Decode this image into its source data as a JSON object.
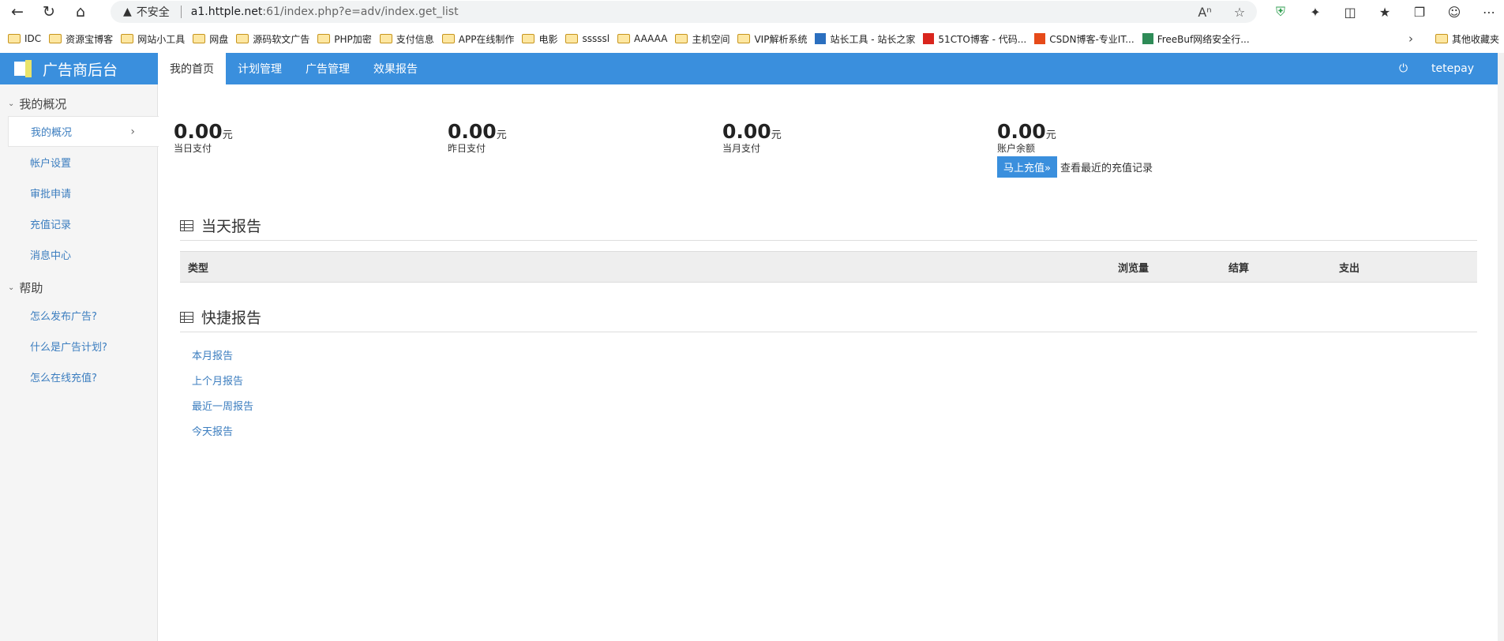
{
  "browser": {
    "security_label": "不安全",
    "url_host": "a1.httple.net",
    "url_rest": ":61/index.php?e=adv/index.get_list"
  },
  "bookmarks": [
    {
      "label": "IDC",
      "icon": "folder"
    },
    {
      "label": "资源宝博客",
      "icon": "folder"
    },
    {
      "label": "网站小工具",
      "icon": "folder"
    },
    {
      "label": "网盘",
      "icon": "folder"
    },
    {
      "label": "源码软文广告",
      "icon": "folder"
    },
    {
      "label": "PHP加密",
      "icon": "folder"
    },
    {
      "label": "支付信息",
      "icon": "folder"
    },
    {
      "label": "APP在线制作",
      "icon": "folder"
    },
    {
      "label": "电影",
      "icon": "folder"
    },
    {
      "label": "sssssl",
      "icon": "folder"
    },
    {
      "label": "AAAAA",
      "icon": "folder"
    },
    {
      "label": "主机空间",
      "icon": "folder"
    },
    {
      "label": "VIP解析系统",
      "icon": "folder"
    },
    {
      "label": "站长工具 - 站长之家",
      "icon": "site"
    },
    {
      "label": "51CTO博客 - 代码...",
      "icon": "site"
    },
    {
      "label": "CSDN博客-专业IT...",
      "icon": "site"
    },
    {
      "label": "FreeBuf网络安全行...",
      "icon": "site"
    }
  ],
  "bookmarks_other": "其他收藏夹",
  "header": {
    "logo_text": "广告商后台",
    "nav": [
      "我的首页",
      "计划管理",
      "广告管理",
      "效果报告"
    ],
    "username": "tetepay"
  },
  "sidebar": {
    "group1": "我的概况",
    "items1": [
      "我的概况",
      "帐户设置",
      "审批申请",
      "充值记录",
      "消息中心"
    ],
    "group2": "帮助",
    "items2": [
      "怎么发布广告?",
      "什么是广告计划?",
      "怎么在线充值?"
    ]
  },
  "stats": [
    {
      "amount": "0.00",
      "unit": "元",
      "label": "当日支付"
    },
    {
      "amount": "0.00",
      "unit": "元",
      "label": "昨日支付"
    },
    {
      "amount": "0.00",
      "unit": "元",
      "label": "当月支付"
    },
    {
      "amount": "0.00",
      "unit": "元",
      "label": "账户余额"
    }
  ],
  "recharge": {
    "button": "马上充值»",
    "link": "查看最近的充值记录"
  },
  "today_report": {
    "title": "当天报告",
    "columns": [
      "类型",
      "浏览量",
      "结算",
      "支出"
    ]
  },
  "quick_report": {
    "title": "快捷报告",
    "links": [
      "本月报告",
      "上个月报告",
      "最近一周报告",
      "今天报告"
    ]
  },
  "colors": {
    "accent": "#3a8fdd",
    "link": "#3b7dbf"
  }
}
